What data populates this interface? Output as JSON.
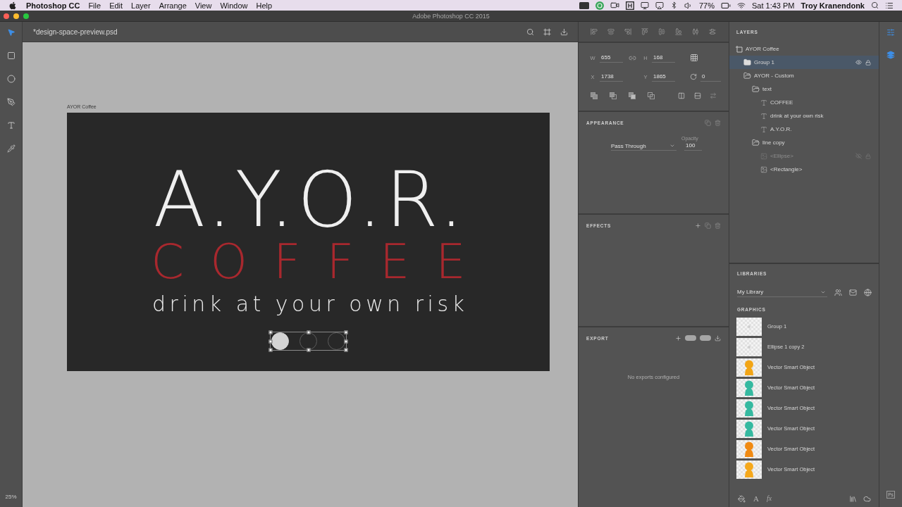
{
  "menu_bar": {
    "app_name": "Photoshop CC",
    "menus": [
      "File",
      "Edit",
      "Layer",
      "Arrange",
      "View",
      "Window",
      "Help"
    ],
    "battery": "77%",
    "clock": "Sat 1:43 PM",
    "user": "Troy Kranendonk"
  },
  "window": {
    "title": "Adobe Photoshop CC 2015"
  },
  "tools": [
    {
      "kind": "select",
      "selected": true
    },
    {
      "kind": "rectangle",
      "selected": false
    },
    {
      "kind": "ellipse",
      "selected": false
    },
    {
      "kind": "pen",
      "selected": false
    },
    {
      "kind": "text",
      "selected": false
    },
    {
      "kind": "eyedropper",
      "selected": false
    }
  ],
  "zoom": "25%",
  "document": {
    "tab": "*design-space-preview.psd",
    "artboard": {
      "label": "AYOR Coffee",
      "headline": "A.Y.O.R.",
      "subhead": "COFFEE",
      "tagline": "drink at your own risk",
      "shapes": [
        {
          "filled": true
        },
        {
          "filled": false
        },
        {
          "filled": false
        }
      ]
    }
  },
  "properties": {
    "size": [
      {
        "label": "W",
        "value": "655"
      },
      {
        "label": "H",
        "value": "168"
      }
    ],
    "position": [
      {
        "label": "X",
        "value": "1738"
      },
      {
        "label": "Y",
        "value": "1865"
      }
    ],
    "rotation": "0",
    "appearance": {
      "title": "APPEARANCE",
      "blend_mode": "Pass Through",
      "opacity_label": "Opacity",
      "opacity": "100"
    },
    "effects": {
      "title": "EFFECTS"
    },
    "export": {
      "title": "EXPORT",
      "message": "No exports configured"
    }
  },
  "layers": {
    "title": "LAYERS",
    "tree": [
      {
        "name": "AYOR Coffee",
        "kind": "artboard",
        "selected": false,
        "hidden": false,
        "children": [
          {
            "name": "Group 1",
            "kind": "group",
            "selected": true,
            "hidden": false,
            "expanded": false
          },
          {
            "name": "AYOR - Custom",
            "kind": "group",
            "selected": false,
            "hidden": false,
            "expanded": true,
            "children": [
              {
                "name": "text",
                "kind": "group",
                "selected": false,
                "hidden": false,
                "expanded": true,
                "children": [
                  {
                    "name": "COFFEE",
                    "kind": "text",
                    "selected": false,
                    "hidden": false
                  },
                  {
                    "name": "drink at your own risk",
                    "kind": "text",
                    "selected": false,
                    "hidden": false
                  },
                  {
                    "name": "A.Y.O.R.",
                    "kind": "text",
                    "selected": false,
                    "hidden": false
                  }
                ]
              },
              {
                "name": "line copy",
                "kind": "group",
                "selected": false,
                "hidden": false,
                "expanded": true,
                "children": [
                  {
                    "name": "<Ellipse>",
                    "kind": "shape",
                    "selected": false,
                    "hidden": true
                  },
                  {
                    "name": "<Rectangle>",
                    "kind": "shape",
                    "selected": false,
                    "hidden": false
                  }
                ]
              }
            ]
          }
        ]
      }
    ]
  },
  "libraries": {
    "title": "LIBRARIES",
    "library": "My Library",
    "section": "GRAPHICS",
    "items": [
      {
        "name": "Group 1"
      },
      {
        "name": "Ellipse 1 copy 2"
      },
      {
        "name": "Vector Smart Object",
        "color": "#f2a516"
      },
      {
        "name": "Vector Smart Object",
        "color": "#35b9a0"
      },
      {
        "name": "Vector Smart Object",
        "color": "#35b9a0"
      },
      {
        "name": "Vector Smart Object",
        "color": "#35b9a0"
      },
      {
        "name": "Vector Smart Object",
        "color": "#f08a12"
      },
      {
        "name": "Vector Smart Object",
        "color": "#f5a81c"
      }
    ],
    "footer_glyphs": [
      "A",
      "fx"
    ]
  },
  "side_strip": {
    "app_button": "Ps"
  }
}
